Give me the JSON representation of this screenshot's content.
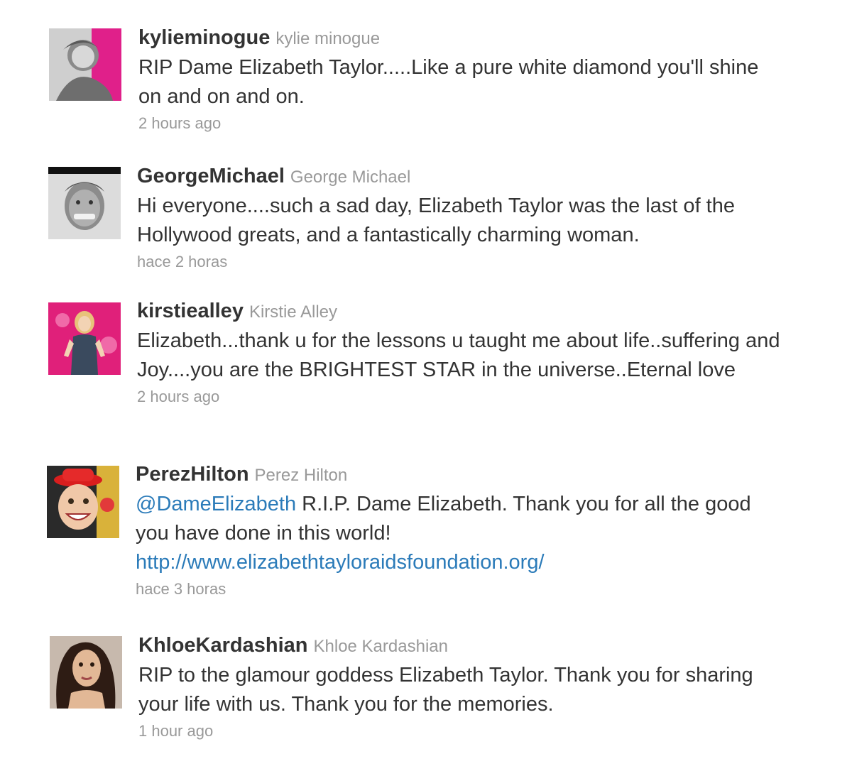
{
  "tweets": [
    {
      "screen_name": "kylieminogue",
      "full_name": "kylie minogue",
      "text": "RIP Dame Elizabeth Taylor.....Like a pure white diamond you'll shine on and on and on.",
      "timestamp": "2 hours ago",
      "avatar_icon": "avatar-photo-kylie"
    },
    {
      "screen_name": "GeorgeMichael",
      "full_name": "George Michael",
      "text": "Hi everyone....such a sad day, Elizabeth Taylor was the last of the Hollywood greats, and a fantastically charming woman.",
      "timestamp": "hace 2 horas",
      "avatar_icon": "avatar-photo-george"
    },
    {
      "screen_name": "kirstiealley",
      "full_name": "Kirstie Alley",
      "text": "Elizabeth...thank u for the lessons u taught me about life..suffering and Joy....you are the BRIGHTEST STAR in the universe..Eternal love",
      "timestamp": "2 hours ago",
      "avatar_icon": "avatar-photo-kirstie"
    },
    {
      "screen_name": "PerezHilton",
      "full_name": "Perez Hilton",
      "mention": "@DameElizabeth",
      "text": " R.I.P. Dame Elizabeth. Thank you for all the good you have done in this world!",
      "link": "http://www.elizabethtayloraidsfoundation.org/",
      "timestamp": "hace 3 horas",
      "avatar_icon": "avatar-photo-perez"
    },
    {
      "screen_name": "KhloeKardashian",
      "full_name": "Khloe Kardashian",
      "text": "RIP to the glamour goddess Elizabeth Taylor. Thank you for sharing your life with us. Thank you for the memories.",
      "timestamp": "1 hour ago",
      "avatar_icon": "avatar-photo-khloe"
    }
  ],
  "colors": {
    "text": "#333333",
    "muted": "#999999",
    "link": "#2b7bb9",
    "kylie_bg": "#e0208a",
    "kirstie_bg": "#e0207a"
  }
}
